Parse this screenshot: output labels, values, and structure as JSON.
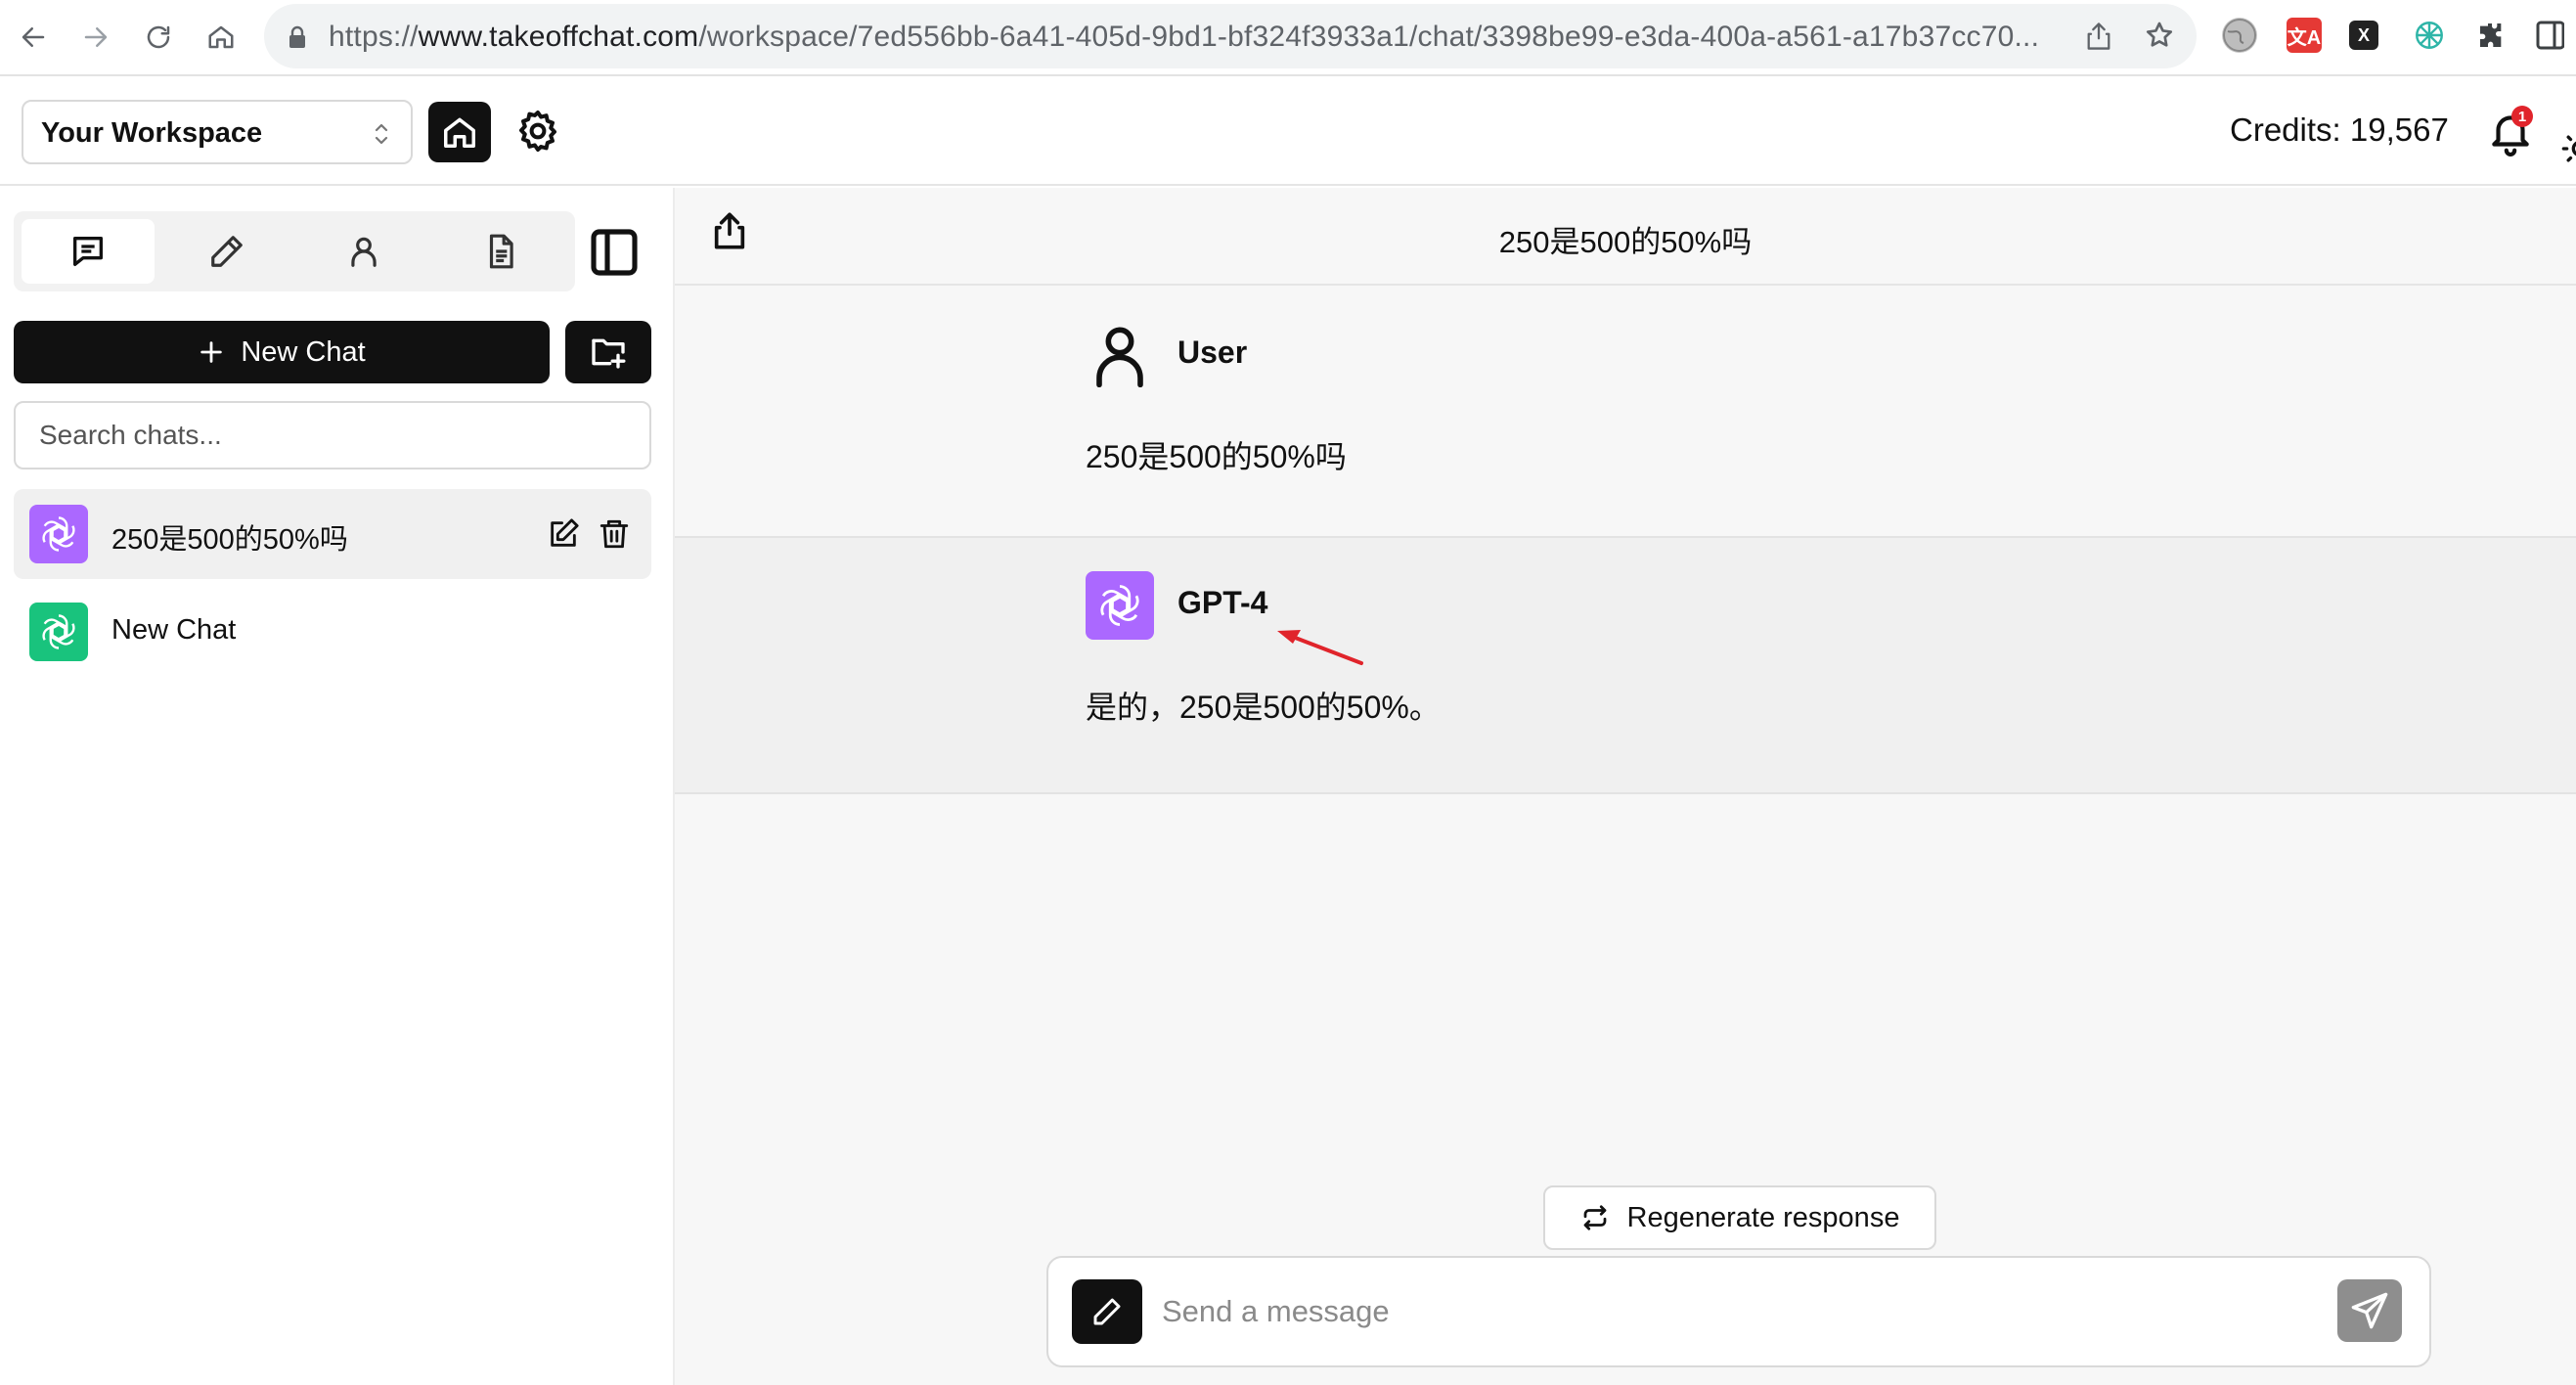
{
  "browser": {
    "url_prefix": "https://",
    "url_host": "www.takeoffchat.com",
    "url_path": "/workspace/7ed556bb-6a41-405d-9bd1-bf324f3933a1/chat/3398be99-e3da-400a-a561-a17b37cc70...",
    "icons": [
      "back-icon",
      "forward-icon",
      "reload-icon",
      "home-icon",
      "lock-icon",
      "share-icon",
      "star-icon",
      "globe-extension-icon",
      "translate-extension-icon",
      "x-extension-icon",
      "openai-extension-icon",
      "puzzle-extension-icon",
      "sidepanel-icon"
    ],
    "translate_extension_glyph": "文A",
    "x_extension_glyph": "X"
  },
  "header": {
    "workspace_label": "Your Workspace",
    "credits_text": "Credits: 19,567",
    "notification_count": "1"
  },
  "sidebar": {
    "tabs": [
      {
        "name": "chats",
        "icon": "message-square-icon",
        "active": true
      },
      {
        "name": "prompts",
        "icon": "pencil-icon",
        "active": false
      },
      {
        "name": "assistants",
        "icon": "user-icon",
        "active": false
      },
      {
        "name": "files",
        "icon": "file-text-icon",
        "active": false
      }
    ],
    "new_chat_label": "New Chat",
    "search_placeholder": "Search chats...",
    "chats": [
      {
        "title": "250是500的50%吗",
        "avatar_color": "#ab68ff",
        "selected": true
      },
      {
        "title": "New Chat",
        "avatar_color": "#19c37d",
        "selected": false
      }
    ]
  },
  "main": {
    "chat_title": "250是500的50%吗",
    "messages": [
      {
        "role": "User",
        "text": "250是500的50%吗"
      },
      {
        "role": "GPT-4",
        "text": "是的，250是500的50%。",
        "avatar_color": "#ab68ff"
      }
    ],
    "regenerate_label": "Regenerate response",
    "composer_placeholder": "Send a message",
    "annotation_arrow_color": "#e0242b"
  }
}
